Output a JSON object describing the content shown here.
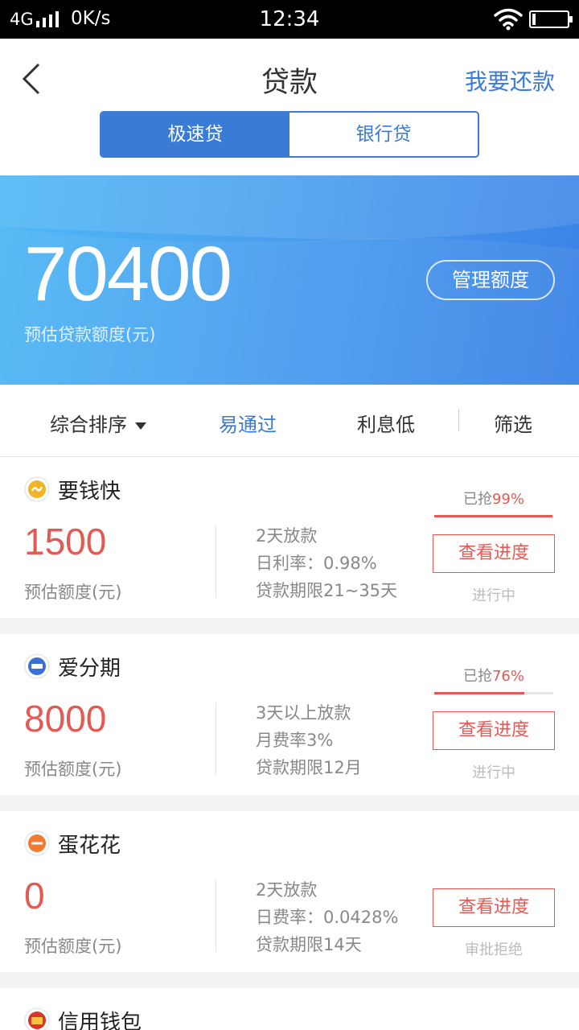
{
  "status_bar": {
    "network": "4G",
    "speed": "0K/s",
    "time": "12:34"
  },
  "header": {
    "title": "贷款",
    "repay_label": "我要还款"
  },
  "segment": {
    "tab1": "极速贷",
    "tab2": "银行贷"
  },
  "banner": {
    "amount": "70400",
    "label": "预估贷款额度(元)",
    "manage_label": "管理额度"
  },
  "sort": {
    "comprehensive": "综合排序",
    "easy": "易通过",
    "low_interest": "利息低",
    "filter": "筛选"
  },
  "cards": [
    {
      "name": "要钱快",
      "amount": "1500",
      "amount_label": "预估额度(元)",
      "details": [
        "2天放款",
        "日利率：0.98%",
        "贷款期限21~35天"
      ],
      "grab_prefix": "已抢",
      "grab_percent": "99%",
      "grab_value": 0.99,
      "button": "查看进度",
      "status": "进行中"
    },
    {
      "name": "爱分期",
      "amount": "8000",
      "amount_label": "预估额度(元)",
      "details": [
        "3天以上放款",
        "月费率3%",
        "贷款期限12月"
      ],
      "grab_prefix": "已抢",
      "grab_percent": "76%",
      "grab_value": 0.76,
      "button": "查看进度",
      "status": "进行中"
    },
    {
      "name": "蛋花花",
      "amount": "0",
      "amount_label": "预估额度(元)",
      "details": [
        "2天放款",
        "日费率：0.0428%",
        "贷款期限14天"
      ],
      "button": "查看进度",
      "status": "审批拒绝"
    }
  ],
  "partial_card": {
    "name": "信用钱包"
  },
  "colors": {
    "accent_blue": "#3a7bd5",
    "accent_red": "#e25a53"
  }
}
